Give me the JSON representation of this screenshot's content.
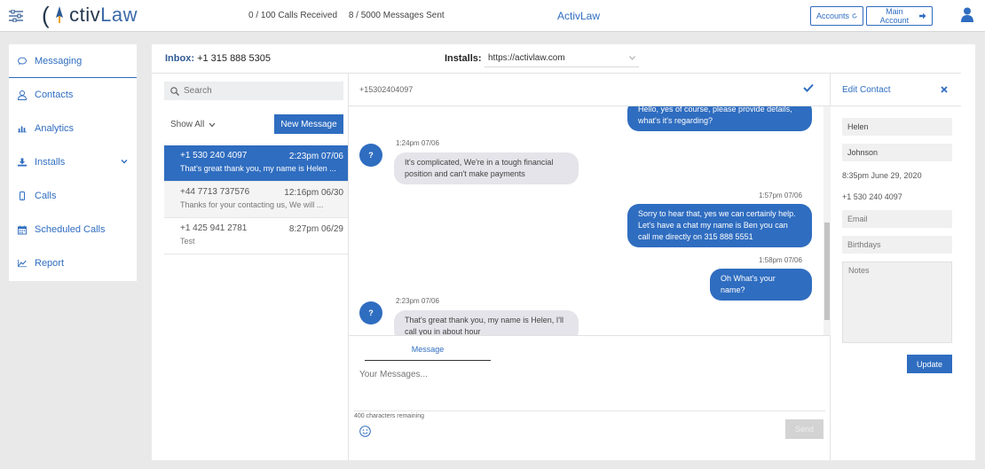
{
  "app": {
    "logo_prefix": "(",
    "logo_mid": "ctiv",
    "logo_suffix": "Law",
    "brand": "ActivLaw"
  },
  "header": {
    "calls": "0 / 100 Calls Received",
    "messages": "8 / 5000 Messages Sent",
    "accounts_label": "Accounts",
    "main_account_label": "Main Account"
  },
  "sidebar": {
    "items": [
      {
        "label": "Messaging",
        "icon": "chat-bubble-icon"
      },
      {
        "label": "Contacts",
        "icon": "person-icon"
      },
      {
        "label": "Analytics",
        "icon": "bar-chart-icon"
      },
      {
        "label": "Installs",
        "icon": "download-icon"
      },
      {
        "label": "Calls",
        "icon": "phone-icon"
      },
      {
        "label": "Scheduled Calls",
        "icon": "calendar-icon"
      },
      {
        "label": "Report",
        "icon": "line-chart-icon"
      }
    ]
  },
  "inbox": {
    "label": "Inbox:",
    "number": "+1 315 888 5305",
    "installs_label": "Installs:",
    "installs_value": "https://activlaw.com"
  },
  "conversations": {
    "search_placeholder": "Search",
    "filter_label": "Show All",
    "new_message_label": "New Message",
    "items": [
      {
        "number": "+1 530 240 4097",
        "time": "2:23pm 07/06",
        "preview": "That's great thank you, my name is Helen ..."
      },
      {
        "number": "+44 7713 737576",
        "time": "12:16pm 06/30",
        "preview": "Thanks for your contacting us, We will ..."
      },
      {
        "number": "+1 425 941 2781",
        "time": "8:27pm 06/29",
        "preview": "Test"
      }
    ]
  },
  "chat": {
    "number": "+15302404097",
    "messages": [
      {
        "dir": "out",
        "text": "Hello, yes of course, please provide details, what's it's regarding?"
      },
      {
        "dir": "in",
        "time": "1:24pm 07/06",
        "avatar": "?",
        "text": "It's complicated, We're in a tough financial position and can't make payments"
      },
      {
        "dir": "out",
        "time": "1:57pm 07/06",
        "text": "Sorry to hear that, yes we can certainly help. Let's have a chat my name is Ben you can call me directly on 315 888 5551"
      },
      {
        "dir": "out",
        "time": "1:58pm 07/06",
        "text": "Oh What's your name?"
      },
      {
        "dir": "in",
        "time": "2:23pm 07/06",
        "avatar": "?",
        "text": "That's great thank you, my name is Helen, I'll call you in about hour"
      }
    ],
    "compose_tab": "Message",
    "compose_placeholder": "Your Messages...",
    "chars_remaining": "400 characters remaining",
    "send_label": "Send"
  },
  "contact": {
    "title": "Edit Contact",
    "first_name": "Helen",
    "last_name": "Johnson",
    "created": "8:35pm June 29, 2020",
    "phone": "+1 530 240 4097",
    "email_placeholder": "Email",
    "birthday_placeholder": "Birthdays",
    "notes_placeholder": "Notes",
    "update_label": "Update"
  },
  "colors": {
    "accent": "#2f6dc0",
    "incoming_bubble": "#e4e4ea"
  }
}
